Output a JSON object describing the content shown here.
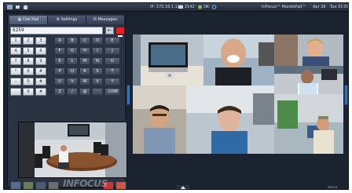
{
  "topbar": {
    "ip": "IP: 172.16.1.122",
    "ext": "2142",
    "status_ok": "OK",
    "title": "InFocus™ MondoPad™",
    "date": "Apr 26",
    "time": "Tue 01:09"
  },
  "tabs": [
    {
      "label": "Dial Pad",
      "icon": "keypad-icon"
    },
    {
      "label": "Settings",
      "icon": "gear-icon"
    },
    {
      "label": "Messages",
      "icon": "message-icon"
    }
  ],
  "dial": {
    "value": "6259",
    "backspace": "←"
  },
  "keypad": {
    "rows": [
      [
        "1",
        "2",
        "3",
        "A",
        "B",
        "C",
        "D",
        "E"
      ],
      [
        "4",
        "5",
        "6",
        "F",
        "G",
        "H",
        "I",
        "J"
      ],
      [
        "7",
        "8",
        "9",
        "K",
        "L",
        "M",
        "N",
        "O"
      ],
      [
        "*",
        "0",
        "#",
        "P",
        "Q",
        "R",
        "S",
        "T"
      ],
      [
        "-",
        "0",
        "#",
        "U",
        "V",
        "W",
        "X",
        "Y"
      ],
      [
        "·",
        "0",
        "#",
        "Z",
        "/",
        "@",
        "",
        ".COM"
      ]
    ]
  },
  "bottom_bar": {
    "watermark": "INFOCUS",
    "corner_label": "Vanna"
  },
  "colors": {
    "accent": "#3b6fb1",
    "call_button": "#d8262a",
    "panel_bg": "#2a3342"
  }
}
